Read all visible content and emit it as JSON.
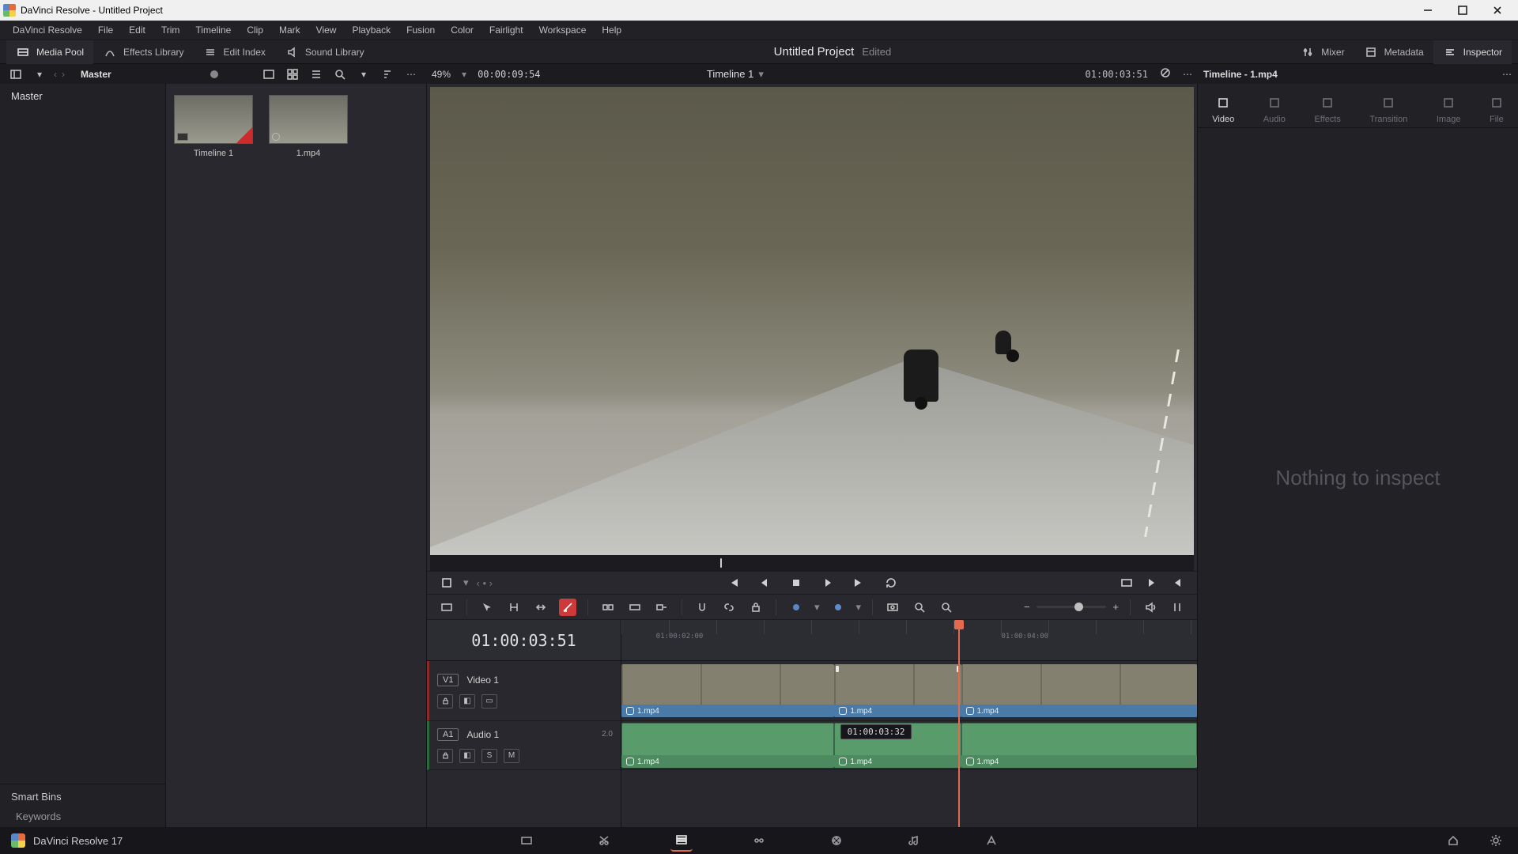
{
  "window": {
    "title": "DaVinci Resolve - Untitled Project"
  },
  "menu": [
    "DaVinci Resolve",
    "File",
    "Edit",
    "Trim",
    "Timeline",
    "Clip",
    "Mark",
    "View",
    "Playback",
    "Fusion",
    "Color",
    "Fairlight",
    "Workspace",
    "Help"
  ],
  "pagetabs": {
    "media_pool": "Media Pool",
    "effects_library": "Effects Library",
    "edit_index": "Edit Index",
    "sound_library": "Sound Library",
    "mixer": "Mixer",
    "metadata": "Metadata",
    "inspector": "Inspector",
    "project_title": "Untitled Project",
    "edited": "Edited"
  },
  "pool_header": {
    "master": "Master",
    "zoom": "49%",
    "source_tc": "00:00:09:54",
    "timeline_name": "Timeline 1",
    "record_tc": "01:00:03:51",
    "inspector_title": "Timeline - 1.mp4"
  },
  "bins": {
    "master": "Master",
    "smart_bins": "Smart Bins",
    "keywords": "Keywords"
  },
  "clips": [
    {
      "name": "Timeline 1",
      "kind": "timeline"
    },
    {
      "name": "1.mp4",
      "kind": "av"
    }
  ],
  "inspector": {
    "tabs": [
      "Video",
      "Audio",
      "Effects",
      "Transition",
      "Image",
      "File"
    ],
    "active": 0,
    "empty": "Nothing to inspect"
  },
  "transport": {
    "mode": "stopped"
  },
  "timeline": {
    "tc": "01:00:03:51",
    "ruler_labels": [
      {
        "left_pct": 6,
        "text": "01:00:02:00"
      },
      {
        "left_pct": 66,
        "text": "01:00:04:00"
      }
    ],
    "playhead_pct": 58.5,
    "scrub_pct": 38,
    "hover_tc": "01:00:03:32",
    "hover_left_pct": 38,
    "tracks": {
      "v1": {
        "tag": "V1",
        "name": "Video 1"
      },
      "a1": {
        "tag": "A1",
        "name": "Audio 1",
        "ch": "2.0"
      }
    },
    "segments": [
      {
        "name": "1.mp4",
        "left_pct": 0,
        "width_pct": 37
      },
      {
        "name": "1.mp4",
        "left_pct": 37,
        "width_pct": 22
      },
      {
        "name": "1.mp4",
        "left_pct": 59,
        "width_pct": 41
      }
    ]
  },
  "footer": {
    "app": "DaVinci Resolve 17"
  }
}
